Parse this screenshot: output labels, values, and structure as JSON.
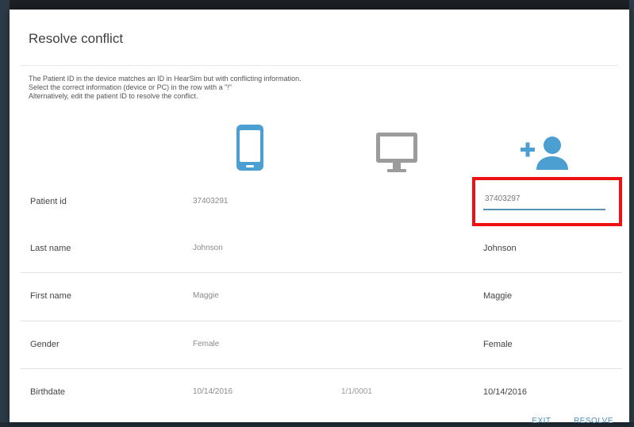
{
  "dialog": {
    "title": "Resolve conflict",
    "description": [
      "The Patient ID in the device matches an ID in HearSim but with conflicting information.",
      "Select the correct information (device or PC) in the row with a \"!\"",
      "Alternatively, edit the patient ID to resolve the conflict."
    ]
  },
  "columns": {
    "device_icon": "phone-icon",
    "pc_icon": "monitor-icon",
    "new_icon": "add-person-icon"
  },
  "rows": {
    "patient_id": {
      "label": "Patient id",
      "device": "37403291",
      "pc": "",
      "value": "37403297"
    },
    "last_name": {
      "label": "Last name",
      "device": "Johnson",
      "pc": "",
      "value": "Johnson"
    },
    "first_name": {
      "label": "First name",
      "device": "Maggie",
      "pc": "",
      "value": "Maggie"
    },
    "gender": {
      "label": "Gender",
      "device": "Female",
      "pc": "",
      "value": "Female"
    },
    "birthdate": {
      "label": "Birthdate",
      "device": "10/14/2016",
      "pc": "1/1/0001",
      "value": "10/14/2016"
    }
  },
  "actions": {
    "exit": "EXIT",
    "resolve": "RESOLVE"
  },
  "colors": {
    "icon_blue": "#4b9fd1",
    "icon_gray": "#9b9b9b",
    "highlight": "#ee1111"
  }
}
